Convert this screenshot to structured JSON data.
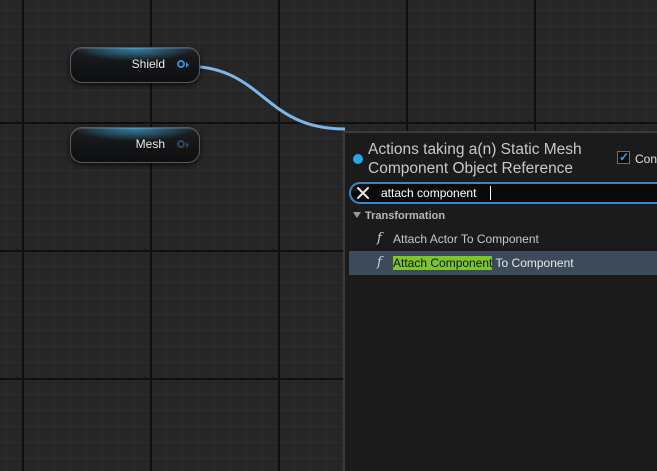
{
  "graph": {
    "nodes": [
      {
        "label": "Shield",
        "connected": true
      },
      {
        "label": "Mesh",
        "connected": false
      }
    ],
    "wire_color": "#7ab8ea"
  },
  "action_menu": {
    "title": "Actions taking a(n) Static Mesh Component Object Reference",
    "context_label": "Context Sensitive",
    "context_checked": true,
    "search": {
      "value": "attach component",
      "clear_icon": "close-icon"
    },
    "category": "Transformation",
    "items": [
      {
        "icon": "function-icon",
        "label": "Attach Actor To Component",
        "match": "",
        "rest": "Attach Actor To Component",
        "selected": false
      },
      {
        "icon": "function-icon",
        "label": "Attach Component To Component",
        "match": "Attach Component",
        "rest": " To Component",
        "selected": true
      }
    ],
    "highlight_color": "#7cc62d",
    "accent_color": "#2f8ad0"
  }
}
